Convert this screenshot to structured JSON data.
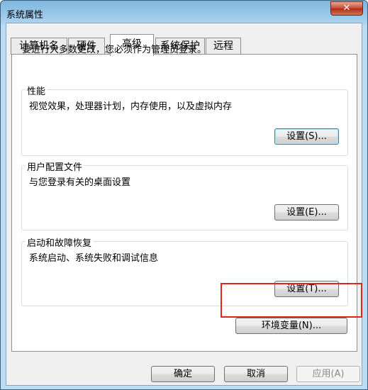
{
  "window": {
    "title": "系统属性",
    "close_glyph": "✕"
  },
  "tabs": [
    {
      "label": "计算机名",
      "active": false
    },
    {
      "label": "硬件",
      "active": false
    },
    {
      "label": "高级",
      "active": true
    },
    {
      "label": "系统保护",
      "active": false
    },
    {
      "label": "远程",
      "active": false
    }
  ],
  "admin_note": "要进行大多数更改，您必须作为管理员登录。",
  "groups": {
    "performance": {
      "title": "性能",
      "description": "视觉效果，处理器计划，内存使用，以及虚拟内存",
      "button": "设置(S)..."
    },
    "user_profiles": {
      "title": "用户配置文件",
      "description": "与您登录有关的桌面设置",
      "button": "设置(E)..."
    },
    "startup_recovery": {
      "title": "启动和故障恢复",
      "description": "系统启动、系统失败和调试信息",
      "button": "设置(T)..."
    }
  },
  "env_button": "环境变量(N)...",
  "footer": {
    "ok": "确定",
    "cancel": "取消",
    "apply": "应用(A)"
  },
  "colors": {
    "highlight": "#e0251b",
    "titlebar": "#a9d1ee",
    "close": "#c2462f"
  }
}
